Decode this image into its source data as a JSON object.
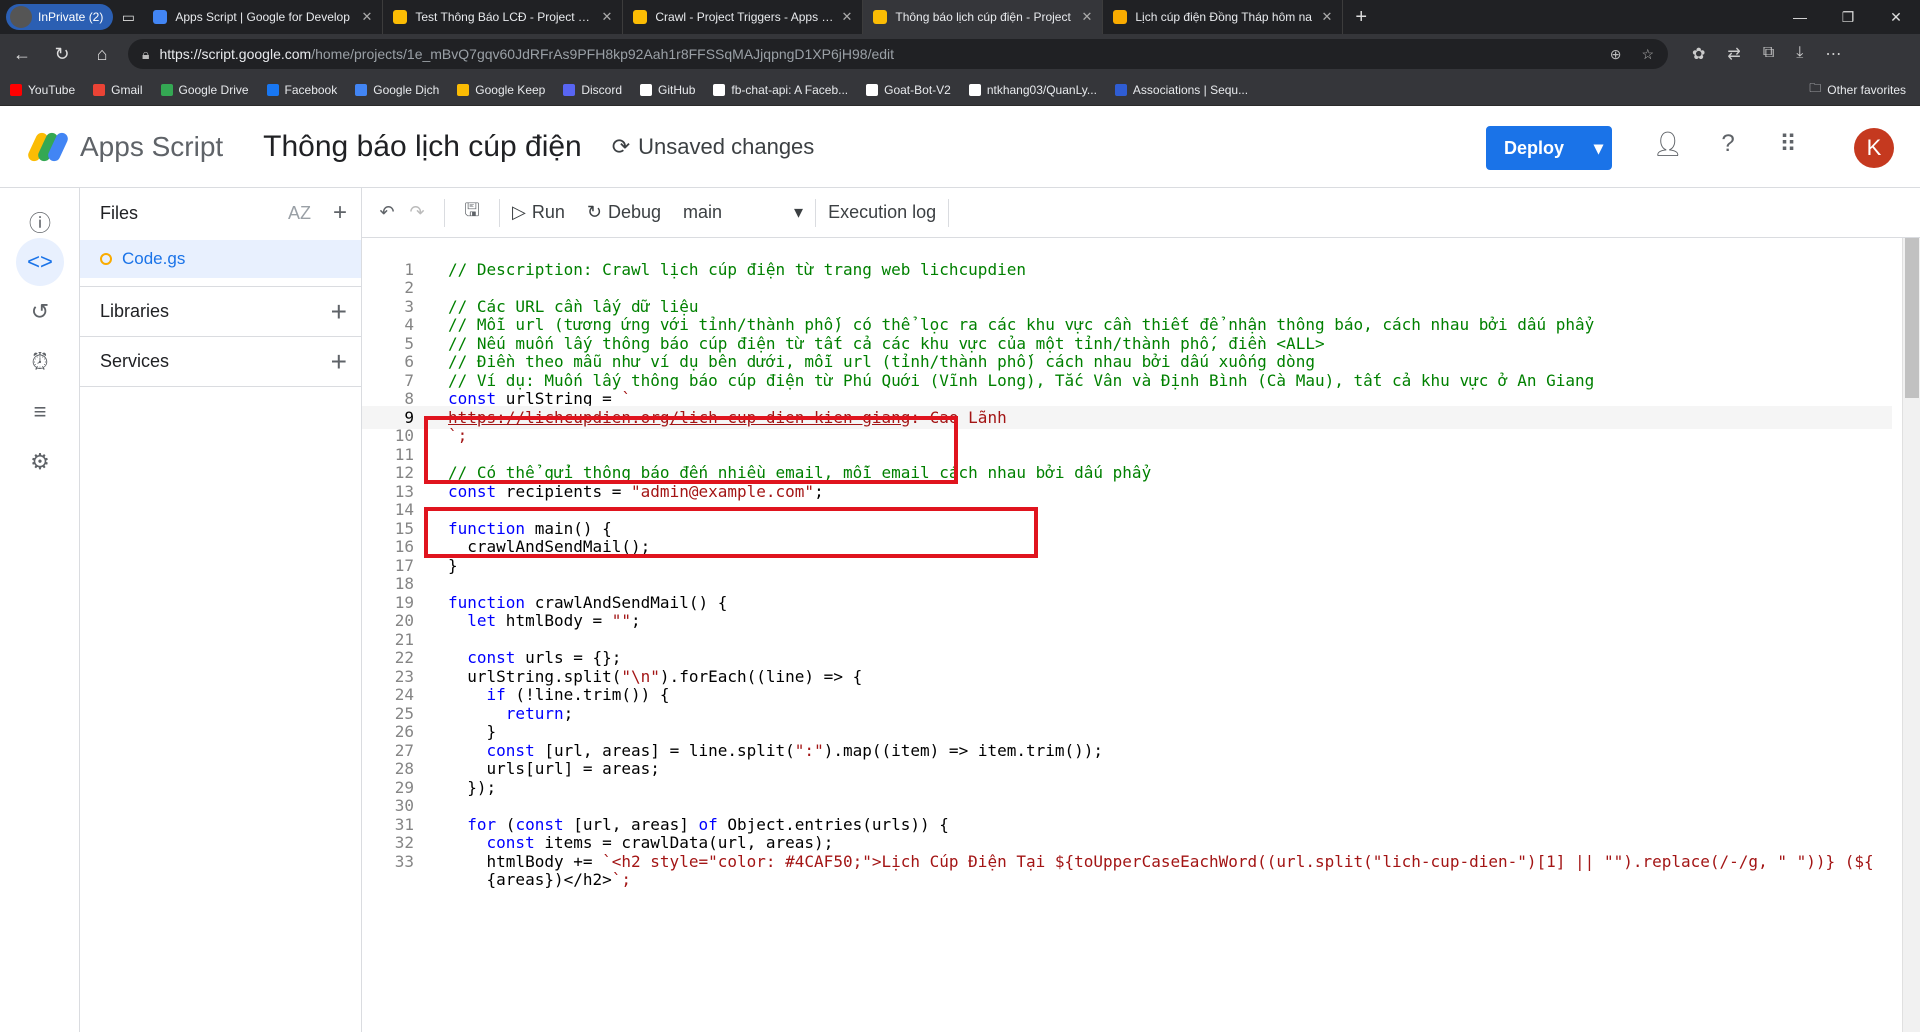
{
  "browser": {
    "inprivate_label": "InPrivate (2)",
    "tabs": [
      {
        "title": "Apps Script | Google for Develop",
        "color": "#4285f4",
        "active": false
      },
      {
        "title": "Test Thông Báo LCĐ - Project Edit",
        "color": "#fbbc04",
        "active": false
      },
      {
        "title": "Crawl - Project Triggers - Apps Sc",
        "color": "#fbbc04",
        "active": false
      },
      {
        "title": "Thông báo lịch cúp điện - Project",
        "color": "#fbbc04",
        "active": true
      },
      {
        "title": "Lịch cúp điện Đồng Tháp hôm na",
        "color": "#f9ab00",
        "active": false
      }
    ],
    "url_host": "https://script.google.com",
    "url_path": "/home/projects/1e_mBvQ7gqv60JdRFrAs9PFH8kp92Aah1r8FFSSqMAJjqpngD1XP6jH98/edit",
    "bookmarks": [
      {
        "label": "YouTube",
        "color": "#ff0000"
      },
      {
        "label": "Gmail",
        "color": "#ea4335"
      },
      {
        "label": "Google Drive",
        "color": "#34a853"
      },
      {
        "label": "Facebook",
        "color": "#1877f2"
      },
      {
        "label": "Google Dịch",
        "color": "#4285f4"
      },
      {
        "label": "Google Keep",
        "color": "#fbbc04"
      },
      {
        "label": "Discord",
        "color": "#5865f2"
      },
      {
        "label": "GitHub",
        "color": "#ffffff"
      },
      {
        "label": "fb-chat-api: A Faceb...",
        "color": "#ffffff"
      },
      {
        "label": "Goat-Bot-V2",
        "color": "#ffffff"
      },
      {
        "label": "ntkhang03/QuanLy...",
        "color": "#ffffff"
      },
      {
        "label": "Associations | Sequ...",
        "color": "#2f5dd3"
      }
    ],
    "other_favorites": "Other favorites"
  },
  "app": {
    "name": "Apps Script",
    "project": "Thông báo lịch cúp điện",
    "status": "Unsaved changes",
    "deploy": "Deploy",
    "avatar_letter": "K"
  },
  "files_panel": {
    "title": "Files",
    "sort_label": "AZ",
    "file": "Code.gs",
    "libraries": "Libraries",
    "services": "Services"
  },
  "toolbar": {
    "run": "Run",
    "debug": "Debug",
    "function": "main",
    "execution_log": "Execution log"
  },
  "code_lines": [
    "// Description: Crawl lịch cúp điện từ trang web lichcupdien",
    "",
    "// Các URL cần lấy dữ liệu",
    "// Mỗi url (tương ứng với tỉnh/thành phố) có thể lọc ra các khu vực cần thiết để nhận thông báo, cách nhau bởi dấu phẩy",
    "// Nếu muốn lấy thông báo cúp điện từ tất cả các khu vực của một tỉnh/thành phố, điền <ALL>",
    "// Điền theo mẫu như ví dụ bên dưới, mỗi url (tỉnh/thành phố) cách nhau bởi dấu xuống dòng",
    "// Ví dụ: Muốn lấy thông báo cúp điện từ Phú Quới (Vĩnh Long), Tắc Vân và Định Bình (Cà Mau), tất cả khu vực ở An Giang",
    "const urlString = `",
    "https://lichcupdien.org/lich-cup-dien-kien-giang: Cao Lãnh",
    "`;",
    "",
    "// Có thể gửi thông báo đến nhiều email, mỗi email cách nhau bởi dấu phẩy",
    "const recipients = \"admin@example.com\";",
    "",
    "function main() {",
    "  crawlAndSendMail();",
    "}",
    "",
    "function crawlAndSendMail() {",
    "  let htmlBody = \"\";",
    "",
    "  const urls = {};",
    "  urlString.split(\"\\n\").forEach((line) => {",
    "    if (!line.trim()) {",
    "      return;",
    "    }",
    "    const [url, areas] = line.split(\":\").map((item) => item.trim());",
    "    urls[url] = areas;",
    "  });",
    "",
    "  for (const [url, areas] of Object.entries(urls)) {",
    "    const items = crawlData(url, areas);",
    "    htmlBody += `<h2 style=\"color: #4CAF50;\">Lịch Cúp Điện Tại ${toUpperCaseEachWord((url.split(\"lich-cup-dien-\")[1] || \"\").replace(/-/g, \" \"))} (${",
    "    {areas})</h2>`;"
  ],
  "current_line": 9,
  "colors": {
    "accent": "#1a73e8",
    "highlight_box": "#e0141e"
  }
}
